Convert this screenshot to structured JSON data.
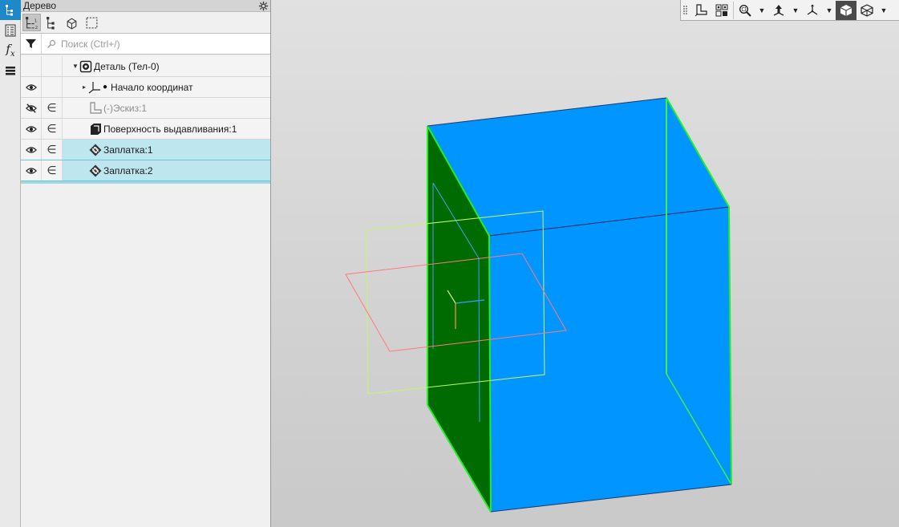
{
  "panel": {
    "title": "Дерево",
    "search_placeholder": "Поиск (Ctrl+/)"
  },
  "tree": {
    "rows": [
      {
        "label": "Деталь (Тел-0)",
        "icon": "part-icon",
        "expanded": true
      },
      {
        "label": "Начало координат",
        "icon": "origin-icon",
        "visibility": "visible"
      },
      {
        "label": "(-)Эскиз:1",
        "icon": "sketch-icon",
        "visibility": "hidden",
        "dimmed": true
      },
      {
        "label": "Поверхность выдавливания:1",
        "icon": "extrude-surface-icon",
        "visibility": "visible"
      },
      {
        "label": "Заплатка:1",
        "icon": "patch-icon",
        "visibility": "visible",
        "selected": true
      },
      {
        "label": "Заплатка:2",
        "icon": "patch-icon",
        "visibility": "visible",
        "selected": true
      }
    ]
  },
  "colors": {
    "accent": "#1e88c8",
    "selection": "#bde6ef",
    "face_blue": "#0095ff",
    "face_green": "#006b00",
    "edge_green": "#22ee22"
  },
  "toolbar_icons": [
    "grip-icon",
    "sketch-plane-icon",
    "filter-select-icon",
    "zoom-icon",
    "dropdown-arrow",
    "orient-icon",
    "dropdown-arrow",
    "axes-icon",
    "dropdown-arrow",
    "shaded-cube-icon",
    "wireframe-cube-icon",
    "dropdown-arrow"
  ]
}
